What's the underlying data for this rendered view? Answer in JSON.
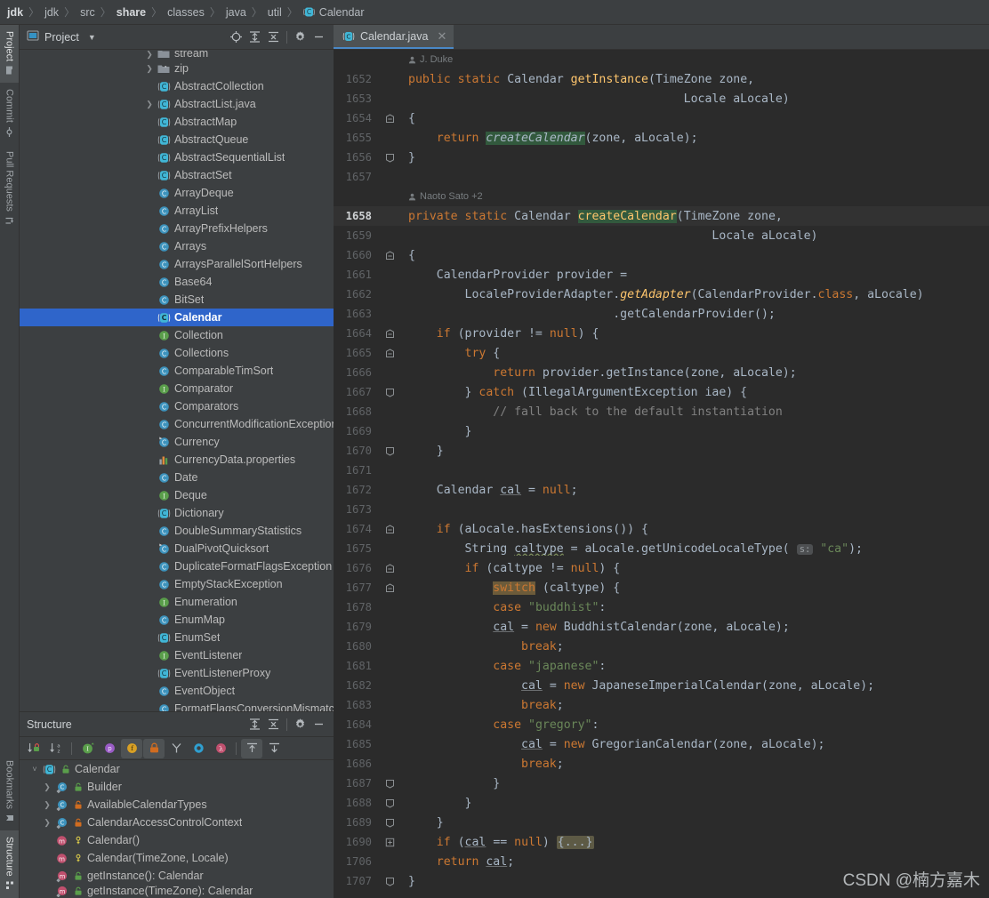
{
  "breadcrumb": {
    "segments": [
      {
        "label": "jdk",
        "bold": true,
        "icon": ""
      },
      {
        "label": "jdk",
        "bold": false,
        "icon": ""
      },
      {
        "label": "src",
        "bold": false,
        "icon": ""
      },
      {
        "label": "share",
        "bold": true,
        "icon": ""
      },
      {
        "label": "classes",
        "bold": false,
        "icon": ""
      },
      {
        "label": "java",
        "bold": false,
        "icon": ""
      },
      {
        "label": "util",
        "bold": false,
        "icon": ""
      },
      {
        "label": "Calendar",
        "bold": false,
        "icon": "abstract-class-icon"
      }
    ],
    "separator": "〉"
  },
  "left_strip": {
    "top_tabs": [
      {
        "label": "Project",
        "icon": "project-icon",
        "active": true
      },
      {
        "label": "Commit",
        "icon": "commit-icon",
        "active": false
      },
      {
        "label": "Pull Requests",
        "icon": "pull-request-icon",
        "active": false
      }
    ],
    "bottom_tabs": [
      {
        "label": "Bookmarks",
        "icon": "bookmark-icon",
        "active": false
      },
      {
        "label": "Structure",
        "icon": "structure-icon",
        "active": true
      }
    ]
  },
  "project_panel": {
    "title": "Project",
    "dropdown_icon": "chevron-down-icon",
    "toolbar": [
      {
        "name": "select-opened-file-icon",
        "glyph": "crosshair"
      },
      {
        "name": "expand-all-icon",
        "glyph": "expand"
      },
      {
        "name": "collapse-all-icon",
        "glyph": "collapse"
      },
      {
        "name": "settings-gear-icon",
        "glyph": "gear"
      },
      {
        "name": "hide-panel-icon",
        "glyph": "minus"
      }
    ],
    "tree": [
      {
        "label": "stream",
        "icon": "folder-icon",
        "arrow": "collapsed",
        "depth": 2,
        "cut": true
      },
      {
        "label": "zip",
        "icon": "folder-icon",
        "arrow": "collapsed",
        "depth": 2,
        "selected": false
      },
      {
        "label": "AbstractCollection",
        "icon": "abstract-class-icon",
        "arrow": "none",
        "depth": 3
      },
      {
        "label": "AbstractList.java",
        "icon": "abstract-class-icon",
        "arrow": "collapsed",
        "depth": 3
      },
      {
        "label": "AbstractMap",
        "icon": "abstract-class-icon",
        "arrow": "none",
        "depth": 3
      },
      {
        "label": "AbstractQueue",
        "icon": "abstract-class-icon",
        "arrow": "none",
        "depth": 3
      },
      {
        "label": "AbstractSequentialList",
        "icon": "abstract-class-icon",
        "arrow": "none",
        "depth": 3
      },
      {
        "label": "AbstractSet",
        "icon": "abstract-class-icon",
        "arrow": "none",
        "depth": 3
      },
      {
        "label": "ArrayDeque",
        "icon": "class-icon",
        "arrow": "none",
        "depth": 3
      },
      {
        "label": "ArrayList",
        "icon": "class-icon",
        "arrow": "none",
        "depth": 3
      },
      {
        "label": "ArrayPrefixHelpers",
        "icon": "class-icon",
        "arrow": "none",
        "depth": 3
      },
      {
        "label": "Arrays",
        "icon": "class-icon",
        "arrow": "none",
        "depth": 3
      },
      {
        "label": "ArraysParallelSortHelpers",
        "icon": "class-icon",
        "arrow": "none",
        "depth": 3
      },
      {
        "label": "Base64",
        "icon": "class-icon",
        "arrow": "none",
        "depth": 3
      },
      {
        "label": "BitSet",
        "icon": "class-icon",
        "arrow": "none",
        "depth": 3
      },
      {
        "label": "Calendar",
        "icon": "abstract-class-icon",
        "arrow": "none",
        "depth": 3,
        "selected": true
      },
      {
        "label": "Collection",
        "icon": "interface-icon",
        "arrow": "none",
        "depth": 3
      },
      {
        "label": "Collections",
        "icon": "class-icon",
        "arrow": "none",
        "depth": 3
      },
      {
        "label": "ComparableTimSort",
        "icon": "class-icon",
        "arrow": "none",
        "depth": 3
      },
      {
        "label": "Comparator",
        "icon": "interface-icon",
        "arrow": "none",
        "depth": 3
      },
      {
        "label": "Comparators",
        "icon": "class-icon",
        "arrow": "none",
        "depth": 3
      },
      {
        "label": "ConcurrentModificationException",
        "icon": "class-icon",
        "arrow": "none",
        "depth": 3
      },
      {
        "label": "Currency",
        "icon": "final-class-icon",
        "arrow": "none",
        "depth": 3
      },
      {
        "label": "CurrencyData.properties",
        "icon": "properties-icon",
        "arrow": "none",
        "depth": 3
      },
      {
        "label": "Date",
        "icon": "class-icon",
        "arrow": "none",
        "depth": 3
      },
      {
        "label": "Deque",
        "icon": "interface-icon",
        "arrow": "none",
        "depth": 3
      },
      {
        "label": "Dictionary",
        "icon": "abstract-class-icon",
        "arrow": "none",
        "depth": 3
      },
      {
        "label": "DoubleSummaryStatistics",
        "icon": "class-icon",
        "arrow": "none",
        "depth": 3
      },
      {
        "label": "DualPivotQuicksort",
        "icon": "final-class-icon",
        "arrow": "none",
        "depth": 3
      },
      {
        "label": "DuplicateFormatFlagsException",
        "icon": "class-icon",
        "arrow": "none",
        "depth": 3
      },
      {
        "label": "EmptyStackException",
        "icon": "class-icon",
        "arrow": "none",
        "depth": 3
      },
      {
        "label": "Enumeration",
        "icon": "interface-icon",
        "arrow": "none",
        "depth": 3
      },
      {
        "label": "EnumMap",
        "icon": "class-icon",
        "arrow": "none",
        "depth": 3
      },
      {
        "label": "EnumSet",
        "icon": "abstract-class-icon",
        "arrow": "none",
        "depth": 3
      },
      {
        "label": "EventListener",
        "icon": "interface-icon",
        "arrow": "none",
        "depth": 3
      },
      {
        "label": "EventListenerProxy",
        "icon": "abstract-class-icon",
        "arrow": "none",
        "depth": 3
      },
      {
        "label": "EventObject",
        "icon": "class-icon",
        "arrow": "none",
        "depth": 3
      },
      {
        "label": "FormatFlagsConversionMismatchException",
        "icon": "class-icon",
        "arrow": "none",
        "depth": 3
      }
    ]
  },
  "structure_panel": {
    "title": "Structure",
    "header_buttons": [
      {
        "name": "expand-all-icon",
        "glyph": "expand"
      },
      {
        "name": "collapse-all-icon",
        "glyph": "collapse"
      },
      {
        "name": "settings-gear-icon",
        "glyph": "gear"
      },
      {
        "name": "hide-panel-icon",
        "glyph": "minus"
      }
    ],
    "toolbar": [
      {
        "name": "sort-by-visibility-icon",
        "active": false
      },
      {
        "name": "sort-alphabetically-icon",
        "active": false
      },
      {
        "name": "show-inherited-icon",
        "active": false
      },
      {
        "name": "show-properties-icon",
        "active": false
      },
      {
        "name": "show-fields-icon",
        "active": true
      },
      {
        "name": "show-non-public-icon",
        "active": true
      },
      {
        "name": "show-anonymous-icon",
        "active": false
      },
      {
        "name": "show-interfaces-icon",
        "active": false
      },
      {
        "name": "show-lambdas-icon",
        "active": false
      },
      {
        "name": "scroll-from-source-icon",
        "active": true
      },
      {
        "name": "scroll-to-source-icon",
        "active": false
      }
    ],
    "tree": [
      {
        "label": "Calendar",
        "icon": "abstract-class-icon",
        "badge": "public-badge",
        "arrow": "expanded",
        "depth": 0
      },
      {
        "label": "Builder",
        "icon": "inner-class-icon",
        "badge": "public-badge",
        "arrow": "collapsed",
        "depth": 1
      },
      {
        "label": "AvailableCalendarTypes",
        "icon": "inner-class-icon",
        "badge": "private-badge",
        "arrow": "collapsed",
        "depth": 1
      },
      {
        "label": "CalendarAccessControlContext",
        "icon": "inner-class-icon",
        "badge": "private-badge",
        "arrow": "collapsed",
        "depth": 1
      },
      {
        "label": "Calendar()",
        "icon": "method-icon",
        "badge": "protected-badge",
        "arrow": "none",
        "depth": 1
      },
      {
        "label": "Calendar(TimeZone, Locale)",
        "icon": "method-icon",
        "badge": "protected-badge",
        "arrow": "none",
        "depth": 1
      },
      {
        "label": "getInstance(): Calendar",
        "icon": "static-method-icon",
        "badge": "public-badge",
        "arrow": "none",
        "depth": 1
      },
      {
        "label": "getInstance(TimeZone): Calendar",
        "icon": "static-method-icon",
        "badge": "public-badge",
        "arrow": "none",
        "depth": 1,
        "cut": true
      }
    ]
  },
  "editor": {
    "tabs": [
      {
        "label": "Calendar.java",
        "icon": "abstract-class-icon",
        "active": true,
        "close_icon": "close-icon"
      }
    ],
    "annotations": [
      {
        "author": "J. Duke",
        "at_line": 1652
      },
      {
        "author": "Naoto Sato +2",
        "at_line": 1658
      }
    ],
    "current_line": 1658,
    "watermark": "CSDN @楠方嘉木",
    "lines": [
      {
        "n": 1652,
        "fold": "none"
      },
      {
        "n": 1653,
        "fold": "none"
      },
      {
        "n": 1654,
        "fold": "start"
      },
      {
        "n": 1655,
        "fold": "bar"
      },
      {
        "n": 1656,
        "fold": "end"
      },
      {
        "n": 1657,
        "fold": "none"
      },
      {
        "n": 1658,
        "fold": "none",
        "current": true
      },
      {
        "n": 1659,
        "fold": "none"
      },
      {
        "n": 1660,
        "fold": "start"
      },
      {
        "n": 1661,
        "fold": "bar"
      },
      {
        "n": 1662,
        "fold": "bar"
      },
      {
        "n": 1663,
        "fold": "bar"
      },
      {
        "n": 1664,
        "fold": "start"
      },
      {
        "n": 1665,
        "fold": "start"
      },
      {
        "n": 1666,
        "fold": "bar"
      },
      {
        "n": 1667,
        "fold": "end"
      },
      {
        "n": 1668,
        "fold": "bar"
      },
      {
        "n": 1669,
        "fold": "bar"
      },
      {
        "n": 1670,
        "fold": "end"
      },
      {
        "n": 1671,
        "fold": "bar"
      },
      {
        "n": 1672,
        "fold": "bar"
      },
      {
        "n": 1673,
        "fold": "bar"
      },
      {
        "n": 1674,
        "fold": "start"
      },
      {
        "n": 1675,
        "fold": "bar"
      },
      {
        "n": 1676,
        "fold": "start"
      },
      {
        "n": 1677,
        "fold": "start"
      },
      {
        "n": 1678,
        "fold": "bar"
      },
      {
        "n": 1679,
        "fold": "bar"
      },
      {
        "n": 1680,
        "fold": "bar"
      },
      {
        "n": 1681,
        "fold": "bar"
      },
      {
        "n": 1682,
        "fold": "bar"
      },
      {
        "n": 1683,
        "fold": "bar"
      },
      {
        "n": 1684,
        "fold": "bar"
      },
      {
        "n": 1685,
        "fold": "bar"
      },
      {
        "n": 1686,
        "fold": "bar"
      },
      {
        "n": 1687,
        "fold": "end"
      },
      {
        "n": 1688,
        "fold": "end"
      },
      {
        "n": 1689,
        "fold": "end"
      },
      {
        "n": 1690,
        "fold": "collapsed"
      },
      {
        "n": 1706,
        "fold": "bar"
      },
      {
        "n": 1707,
        "fold": "end"
      }
    ],
    "source_text": [
      "    public static Calendar getInstance(TimeZone zone,",
      "                                       Locale aLocale)",
      "    {",
      "        return createCalendar(zone, aLocale);",
      "    }",
      "",
      "    private static Calendar createCalendar(TimeZone zone,",
      "                                           Locale aLocale)",
      "    {",
      "        CalendarProvider provider =",
      "            LocaleProviderAdapter.getAdapter(CalendarProvider.class, aLocale)",
      "                                 .getCalendarProvider();",
      "        if (provider != null) {",
      "            try {",
      "                return provider.getInstance(zone, aLocale);",
      "            } catch (IllegalArgumentException iae) {",
      "                // fall back to the default instantiation",
      "            }",
      "        }",
      "",
      "        Calendar cal = null;",
      "",
      "        if (aLocale.hasExtensions()) {",
      "            String caltype = aLocale.getUnicodeLocaleType( s: \"ca\");",
      "            if (caltype != null) {",
      "                switch (caltype) {",
      "                case \"buddhist\":",
      "                cal = new BuddhistCalendar(zone, aLocale);",
      "                    break;",
      "                case \"japanese\":",
      "                    cal = new JapaneseImperialCalendar(zone, aLocale);",
      "                    break;",
      "                case \"gregory\":",
      "                    cal = new GregorianCalendar(zone, aLocale);",
      "                    break;",
      "                }",
      "            }",
      "        }",
      "        if (cal == null) {...}",
      "        return cal;",
      "    }"
    ]
  }
}
